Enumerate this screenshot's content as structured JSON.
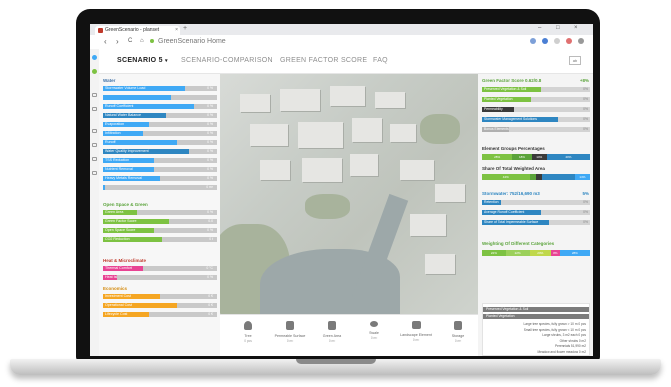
{
  "browser": {
    "tab_title": "GreenScenario - planset",
    "tab_close": "×",
    "new_tab": "+",
    "window_controls": [
      "–",
      "□",
      "×"
    ],
    "nav": [
      "‹",
      "›",
      "C",
      "⌂"
    ],
    "url": "GreenScenario Home"
  },
  "app_nav": {
    "items": [
      "SCENARIO 5",
      "SCENARIO-COMPARISON",
      "GREEN FACTOR SCORE",
      "FAQ"
    ],
    "active_marker": "▾",
    "control_label": "ab"
  },
  "left_panel": {
    "water_title": "Water",
    "water_rows": [
      {
        "label": "Stormwater Volume Load",
        "value": "0 %",
        "fill": 0.72,
        "color": "#3fa9f5"
      },
      {
        "label": "",
        "value": "",
        "fill": 0.6,
        "color": "#3fa9f5"
      },
      {
        "label": "Runoff Coefficient",
        "value": "0 %",
        "fill": 0.8,
        "color": "#3fa9f5"
      },
      {
        "label": "Natural Water Balance",
        "value": "0 %",
        "fill": 0.55,
        "color": "#2e86c1"
      },
      {
        "label": "Evaporation",
        "value": "0 %",
        "fill": 0.4,
        "color": "#3fa9f5"
      },
      {
        "label": "Infiltration",
        "value": "0 %",
        "fill": 0.35,
        "color": "#3fa9f5"
      },
      {
        "label": "Runoff",
        "value": "0 %",
        "fill": 0.65,
        "color": "#3fa9f5"
      },
      {
        "label": "Water Quality Improvement",
        "value": "0 %",
        "fill": 0.75,
        "color": "#2e86c1"
      },
      {
        "label": "TSS Reduction",
        "value": "0 %",
        "fill": 0.45,
        "color": "#3fa9f5"
      },
      {
        "label": "Nutrient Removal",
        "value": "0 %",
        "fill": 0.45,
        "color": "#3fa9f5"
      },
      {
        "label": "Heavy Metals Removal",
        "value": "0 %",
        "fill": 0.5,
        "color": "#3fa9f5"
      },
      {
        "label": "On-site Water Storage",
        "value": "0 m³",
        "fill": 0.0,
        "color": "#3fa9f5"
      }
    ],
    "green_title": "Open Space & Green",
    "green_rows": [
      {
        "label": "Green Area",
        "value": "0 %",
        "fill": 0.3,
        "color": "#7dc242"
      },
      {
        "label": "Green Factor Score",
        "value": "0.0",
        "fill": 0.58,
        "color": "#7dc242"
      },
      {
        "label": "Open Space Score",
        "value": "0 %",
        "fill": 0.45,
        "color": "#7dc242"
      },
      {
        "label": "CO2 Reduction",
        "value": "0 t",
        "fill": 0.52,
        "color": "#7dc242"
      }
    ],
    "heat_title": "Heat & Microclimate",
    "heat_rows": [
      {
        "label": "Thermal Comfort",
        "value": "0 °C",
        "fill": 0.35,
        "color": "#e84393"
      },
      {
        "label": "Heat Island Reduction",
        "value": "0 %",
        "fill": 0.12,
        "color": "#e84393"
      }
    ],
    "economy_title": "Economics",
    "economy_rows": [
      {
        "label": "Investment Cost",
        "value": "0 €",
        "fill": 0.5,
        "color": "#f5a623"
      },
      {
        "label": "Operational Cost",
        "value": "0 €",
        "fill": 0.65,
        "color": "#f5a623"
      },
      {
        "label": "Lifecycle Cost",
        "value": "0 €",
        "fill": 0.4,
        "color": "#f5a623"
      }
    ]
  },
  "toolbar": {
    "tools": [
      {
        "icon": "tree-icon",
        "label": "Tree",
        "value": "0 pcs"
      },
      {
        "icon": "permeable-surface-icon",
        "label": "Permeable Surface",
        "value": "0 m²"
      },
      {
        "icon": "green-area-icon",
        "label": "Green Area",
        "value": "0 m²"
      },
      {
        "icon": "swale-icon",
        "label": "Swale",
        "value": "0 m²"
      },
      {
        "icon": "landscape-element-icon",
        "label": "Landscape Element",
        "value": "0 m²"
      },
      {
        "icon": "storage-icon",
        "label": "Storage",
        "value": "0 m³"
      }
    ]
  },
  "right_panel": {
    "gfs_title": "Green Factor Score 0.62/0.8",
    "gfs_value": "+8%",
    "gfs_rows": [
      {
        "label": "Preserved Vegetation & Soil",
        "fill": 0.55,
        "color": "#7dc242",
        "value": "0%"
      },
      {
        "label": "Planted Vegetation",
        "fill": 0.45,
        "color": "#7dc242",
        "value": "0%"
      },
      {
        "label": "Permeability",
        "fill": 0.3,
        "color": "#3a3a3a",
        "value": "0%"
      },
      {
        "label": "Stormwater Management Solutions",
        "fill": 0.7,
        "color": "#2e86c1",
        "value": "0%"
      },
      {
        "label": "Bonus Elements",
        "fill": 0.25,
        "color": "#b0b0b0",
        "value": "0%"
      }
    ],
    "element_groups_title": "Element Groups Percentages",
    "element_groups": [
      {
        "label": "28%",
        "share": 0.28,
        "color": "#7dc242"
      },
      {
        "label": "18%",
        "share": 0.18,
        "color": "#5aa33a"
      },
      {
        "label": "14%",
        "share": 0.14,
        "color": "#3a3a3a"
      },
      {
        "label": "40%",
        "share": 0.4,
        "color": "#2e86c1"
      }
    ],
    "weighted_area_title": "Share Of Total Weighted Area",
    "weighted_area": [
      {
        "label": "44%",
        "share": 0.44,
        "color": "#7dc242"
      },
      {
        "label": "",
        "share": 0.06,
        "color": "#5aa33a"
      },
      {
        "label": "",
        "share": 0.06,
        "color": "#3a3a3a"
      },
      {
        "label": "",
        "share": 0.3,
        "color": "#2e86c1"
      },
      {
        "label": "14%",
        "share": 0.14,
        "color": "#3fa9f5"
      }
    ],
    "stormwater_title": "Stormwater: 752/16,690 m3",
    "stormwater_value": "5%",
    "stormwater_rows": [
      {
        "label": "Retention",
        "fill": 0.18,
        "color": "#2e86c1",
        "value": "0%"
      },
      {
        "label": "Average Runoff Coefficient",
        "fill": 0.55,
        "color": "#2e86c1",
        "value": "0%"
      },
      {
        "label": "Share of Total Impermeable Surface",
        "fill": 0.62,
        "color": "#2e86c1",
        "value": "0%"
      }
    ],
    "categories_title": "Weighting Of Different Categories",
    "categories": [
      {
        "label": "22%",
        "share": 0.22,
        "color": "#7dc242"
      },
      {
        "label": "22%",
        "share": 0.22,
        "color": "#9bd05a"
      },
      {
        "label": "20%",
        "share": 0.2,
        "color": "#c0d84a"
      },
      {
        "label": "8%",
        "share": 0.08,
        "color": "#e84393"
      },
      {
        "label": "28%",
        "share": 0.28,
        "color": "#3fa9f5"
      }
    ],
    "category_box": {
      "head1": "Preserved Vegetation & Soil",
      "head2": "Planted Vegetation",
      "lines": [
        "Large tree species, fully grown > 10 m   0 pcs",
        "Small tree species, fully grown < 10 m   0 pcs",
        "Large shrubs, 3 m2 each   0 pcs",
        "Other shrubs   0 m2",
        "Perennials   51,990 m2",
        "Meadow and flower meadow   0 m2"
      ]
    }
  }
}
